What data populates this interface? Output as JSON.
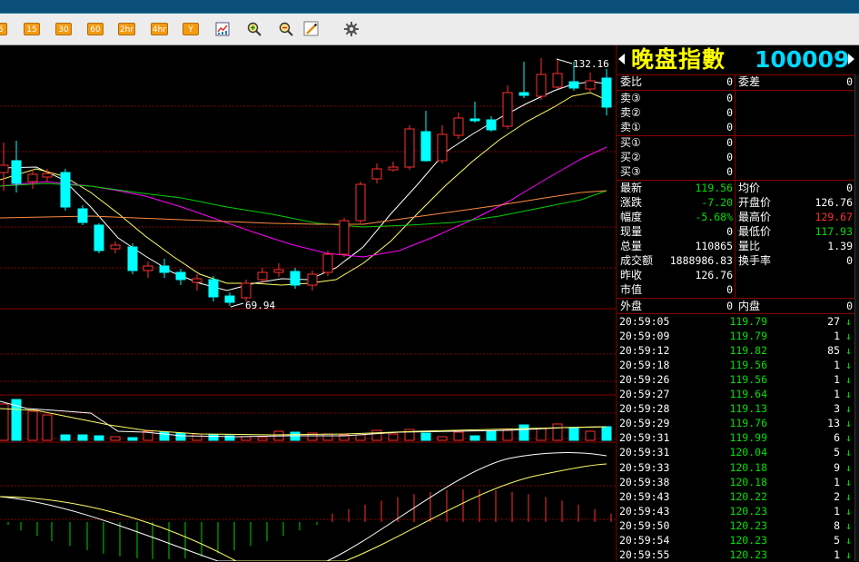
{
  "toolbar": {
    "buttons": [
      "5",
      "15",
      "30",
      "60",
      "2hr",
      "4hr",
      "Y"
    ],
    "icons": [
      "chart-icon",
      "zoom-in-icon",
      "zoom-out-icon",
      "draw-pen-icon",
      "gear-icon"
    ]
  },
  "chart": {
    "high_label": "132.16",
    "low_label": "69.94",
    "colors": {
      "up": "#ff3030",
      "down": "#00ffff",
      "ma5": "#ffffff",
      "ma10": "#ffff66",
      "ma20": "#ff00ff",
      "ma30": "#00d000",
      "ma60": "#ff8a40",
      "grid": "#8a0000"
    }
  },
  "panel": {
    "title": "晚盘指數",
    "code": "100009",
    "weibi": {
      "label": "委比",
      "value": "0"
    },
    "weicha": {
      "label": "委差",
      "value": "0"
    },
    "asks": [
      {
        "label": "卖③",
        "value": "0"
      },
      {
        "label": "卖②",
        "value": "0"
      },
      {
        "label": "卖①",
        "value": "0"
      }
    ],
    "bids": [
      {
        "label": "买①",
        "value": "0"
      },
      {
        "label": "买②",
        "value": "0"
      },
      {
        "label": "买③",
        "value": "0"
      }
    ],
    "stats": [
      {
        "l1": "最新",
        "v1": "119.56",
        "c1": "g",
        "l2": "均价",
        "v2": "0",
        "c2": "w"
      },
      {
        "l1": "涨跌",
        "v1": "-7.20",
        "c1": "g",
        "l2": "开盘价",
        "v2": "126.76",
        "c2": "w"
      },
      {
        "l1": "幅度",
        "v1": "-5.68%",
        "c1": "g",
        "l2": "最高价",
        "v2": "129.67",
        "c2": "r"
      },
      {
        "l1": "现量",
        "v1": "0",
        "c1": "w",
        "l2": "最低价",
        "v2": "117.93",
        "c2": "g"
      },
      {
        "l1": "总量",
        "v1": "110865",
        "c1": "w",
        "l2": "量比",
        "v2": "1.39",
        "c2": "w"
      },
      {
        "l1": "成交额",
        "v1": "1888986.83",
        "c1": "w",
        "l2": "换手率",
        "v2": "0",
        "c2": "w"
      },
      {
        "l1": "昨收",
        "v1": "126.76",
        "c1": "w",
        "l2": "",
        "v2": "",
        "c2": "w"
      },
      {
        "l1": "市值",
        "v1": "0",
        "c1": "w",
        "l2": "",
        "v2": "",
        "c2": "w"
      }
    ],
    "waipan": {
      "label": "外盘",
      "value": "0"
    },
    "neipan": {
      "label": "内盘",
      "value": "0"
    },
    "ticks": [
      {
        "time": "20:59:05",
        "price": "119.79",
        "vol": "27"
      },
      {
        "time": "20:59:09",
        "price": "119.79",
        "vol": "1"
      },
      {
        "time": "20:59:12",
        "price": "119.82",
        "vol": "85"
      },
      {
        "time": "20:59:18",
        "price": "119.56",
        "vol": "1"
      },
      {
        "time": "20:59:26",
        "price": "119.56",
        "vol": "1"
      },
      {
        "time": "20:59:27",
        "price": "119.64",
        "vol": "1"
      },
      {
        "time": "20:59:28",
        "price": "119.13",
        "vol": "3"
      },
      {
        "time": "20:59:29",
        "price": "119.76",
        "vol": "13"
      },
      {
        "time": "20:59:31",
        "price": "119.99",
        "vol": "6"
      },
      {
        "time": "20:59:31",
        "price": "120.04",
        "vol": "5"
      },
      {
        "time": "20:59:33",
        "price": "120.18",
        "vol": "9"
      },
      {
        "time": "20:59:38",
        "price": "120.18",
        "vol": "1"
      },
      {
        "time": "20:59:43",
        "price": "120.22",
        "vol": "2"
      },
      {
        "time": "20:59:43",
        "price": "120.23",
        "vol": "1"
      },
      {
        "time": "20:59:50",
        "price": "120.23",
        "vol": "8"
      },
      {
        "time": "20:59:54",
        "price": "120.23",
        "vol": "5"
      },
      {
        "time": "20:59:55",
        "price": "120.23",
        "vol": "1"
      }
    ],
    "tick_arrow": "↓"
  }
}
